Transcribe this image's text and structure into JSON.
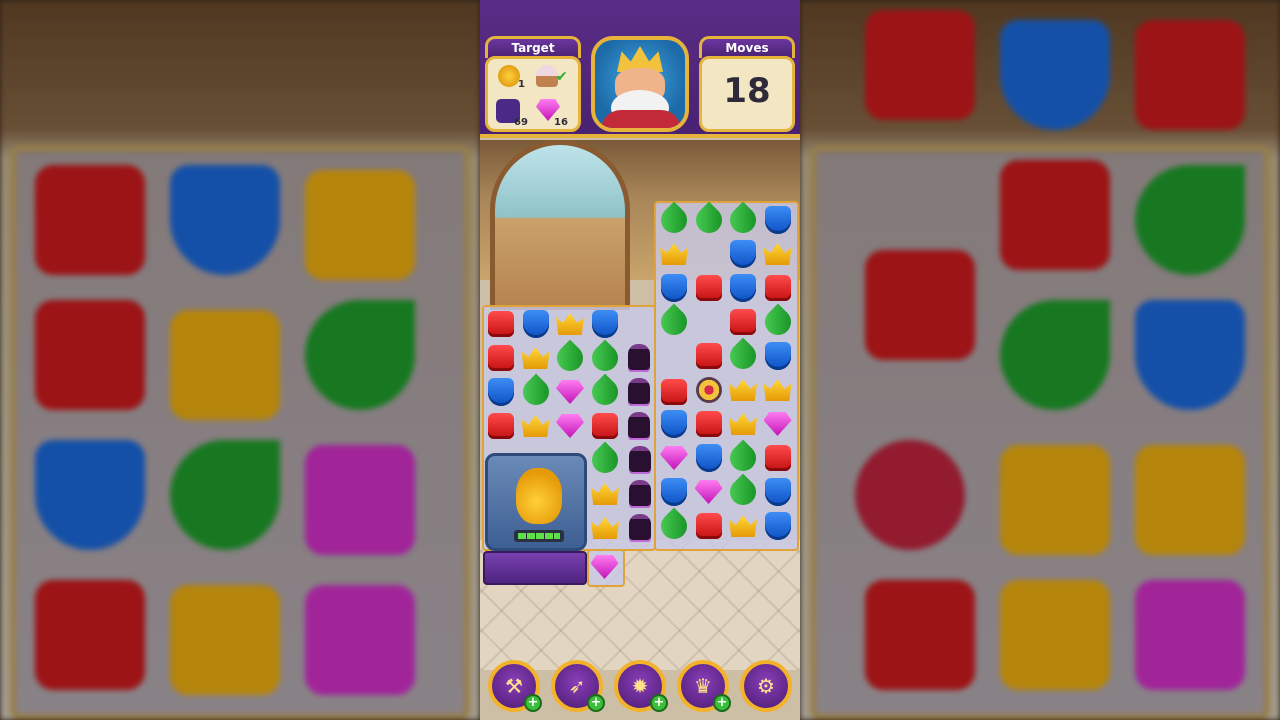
{
  "header": {
    "target_label": "Target",
    "moves_label": "Moves",
    "moves_value": "18"
  },
  "targets": [
    {
      "icon": "duck-icon",
      "count": "1",
      "done": false
    },
    {
      "icon": "cupcake-icon",
      "count": "",
      "done": true
    },
    {
      "icon": "purple-tile-icon",
      "count": "69"
    },
    {
      "icon": "purple-gem-icon",
      "count": "16"
    }
  ],
  "board": {
    "colors": {
      "red": "#e0191c",
      "blue": "#1b6be0",
      "green": "#1fb030",
      "yellow": "#f5b70f",
      "purple": "#e23ad8"
    },
    "duck_progress_segments": 5
  },
  "boosters": [
    {
      "name": "hammer-booster",
      "icon": "hammer-icon",
      "glyph": "⚒"
    },
    {
      "name": "arrow-booster",
      "icon": "arrow-icon",
      "glyph": "➶"
    },
    {
      "name": "cannon-booster",
      "icon": "cannon-icon",
      "glyph": "✹"
    },
    {
      "name": "jester-booster",
      "icon": "jester-hat-icon",
      "glyph": "♛"
    },
    {
      "name": "settings",
      "icon": "gear-icon",
      "glyph": "⚙"
    }
  ],
  "booster_plus": "+"
}
